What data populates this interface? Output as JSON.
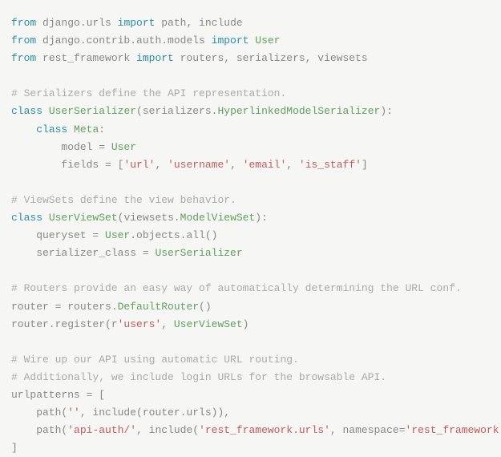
{
  "code": {
    "lines": [
      {
        "type": "import",
        "segments": [
          {
            "t": "kw",
            "v": "from"
          },
          {
            "t": "plain",
            "v": " django.urls "
          },
          {
            "t": "kw",
            "v": "import"
          },
          {
            "t": "plain",
            "v": " path, include"
          }
        ]
      },
      {
        "type": "import",
        "segments": [
          {
            "t": "kw",
            "v": "from"
          },
          {
            "t": "plain",
            "v": " django.contrib.auth.models "
          },
          {
            "t": "kw",
            "v": "import"
          },
          {
            "t": "plain",
            "v": " "
          },
          {
            "t": "cls",
            "v": "User"
          }
        ]
      },
      {
        "type": "import",
        "segments": [
          {
            "t": "kw",
            "v": "from"
          },
          {
            "t": "plain",
            "v": " rest_framework "
          },
          {
            "t": "kw",
            "v": "import"
          },
          {
            "t": "plain",
            "v": " routers, serializers, viewsets"
          }
        ]
      },
      {
        "type": "blank",
        "segments": []
      },
      {
        "type": "comment",
        "segments": [
          {
            "t": "cmt",
            "v": "# Serializers define the API representation."
          }
        ]
      },
      {
        "type": "class",
        "segments": [
          {
            "t": "kw",
            "v": "class"
          },
          {
            "t": "plain",
            "v": " "
          },
          {
            "t": "cls",
            "v": "UserSerializer"
          },
          {
            "t": "plain",
            "v": "(serializers."
          },
          {
            "t": "cls",
            "v": "HyperlinkedModelSerializer"
          },
          {
            "t": "plain",
            "v": "):"
          }
        ]
      },
      {
        "type": "class",
        "segments": [
          {
            "t": "plain",
            "v": "    "
          },
          {
            "t": "kw",
            "v": "class"
          },
          {
            "t": "plain",
            "v": " "
          },
          {
            "t": "cls",
            "v": "Meta"
          },
          {
            "t": "plain",
            "v": ":"
          }
        ]
      },
      {
        "type": "assign",
        "segments": [
          {
            "t": "plain",
            "v": "        model = "
          },
          {
            "t": "cls",
            "v": "User"
          }
        ]
      },
      {
        "type": "assign",
        "segments": [
          {
            "t": "plain",
            "v": "        fields = ["
          },
          {
            "t": "str",
            "v": "'url'"
          },
          {
            "t": "plain",
            "v": ", "
          },
          {
            "t": "str",
            "v": "'username'"
          },
          {
            "t": "plain",
            "v": ", "
          },
          {
            "t": "str",
            "v": "'email'"
          },
          {
            "t": "plain",
            "v": ", "
          },
          {
            "t": "str",
            "v": "'is_staff'"
          },
          {
            "t": "plain",
            "v": "]"
          }
        ]
      },
      {
        "type": "blank",
        "segments": []
      },
      {
        "type": "comment",
        "segments": [
          {
            "t": "cmt",
            "v": "# ViewSets define the view behavior."
          }
        ]
      },
      {
        "type": "class",
        "segments": [
          {
            "t": "kw",
            "v": "class"
          },
          {
            "t": "plain",
            "v": " "
          },
          {
            "t": "cls",
            "v": "UserViewSet"
          },
          {
            "t": "plain",
            "v": "(viewsets."
          },
          {
            "t": "cls",
            "v": "ModelViewSet"
          },
          {
            "t": "plain",
            "v": "):"
          }
        ]
      },
      {
        "type": "assign",
        "segments": [
          {
            "t": "plain",
            "v": "    queryset = "
          },
          {
            "t": "cls",
            "v": "User"
          },
          {
            "t": "plain",
            "v": ".objects.all()"
          }
        ]
      },
      {
        "type": "assign",
        "segments": [
          {
            "t": "plain",
            "v": "    serializer_class = "
          },
          {
            "t": "cls",
            "v": "UserSerializer"
          }
        ]
      },
      {
        "type": "blank",
        "segments": []
      },
      {
        "type": "comment",
        "segments": [
          {
            "t": "cmt",
            "v": "# Routers provide an easy way of automatically determining the URL conf."
          }
        ]
      },
      {
        "type": "assign",
        "segments": [
          {
            "t": "plain",
            "v": "router = routers."
          },
          {
            "t": "cls",
            "v": "DefaultRouter"
          },
          {
            "t": "plain",
            "v": "()"
          }
        ]
      },
      {
        "type": "call",
        "segments": [
          {
            "t": "plain",
            "v": "router.register(r"
          },
          {
            "t": "str",
            "v": "'users'"
          },
          {
            "t": "plain",
            "v": ", "
          },
          {
            "t": "cls",
            "v": "UserViewSet"
          },
          {
            "t": "plain",
            "v": ")"
          }
        ]
      },
      {
        "type": "blank",
        "segments": []
      },
      {
        "type": "comment",
        "segments": [
          {
            "t": "cmt",
            "v": "# Wire up our API using automatic URL routing."
          }
        ]
      },
      {
        "type": "comment",
        "segments": [
          {
            "t": "cmt",
            "v": "# Additionally, we include login URLs for the browsable API."
          }
        ]
      },
      {
        "type": "assign",
        "segments": [
          {
            "t": "plain",
            "v": "urlpatterns = ["
          }
        ]
      },
      {
        "type": "call",
        "segments": [
          {
            "t": "plain",
            "v": "    path("
          },
          {
            "t": "str",
            "v": "''"
          },
          {
            "t": "plain",
            "v": ", include(router.urls)),"
          }
        ]
      },
      {
        "type": "call",
        "segments": [
          {
            "t": "plain",
            "v": "    path("
          },
          {
            "t": "str",
            "v": "'api-auth/'"
          },
          {
            "t": "plain",
            "v": ", include("
          },
          {
            "t": "str",
            "v": "'rest_framework.urls'"
          },
          {
            "t": "plain",
            "v": ", namespace="
          },
          {
            "t": "str",
            "v": "'rest_framework'"
          },
          {
            "t": "plain",
            "v": "))"
          }
        ]
      },
      {
        "type": "assign",
        "segments": [
          {
            "t": "plain",
            "v": "]"
          }
        ]
      }
    ]
  }
}
